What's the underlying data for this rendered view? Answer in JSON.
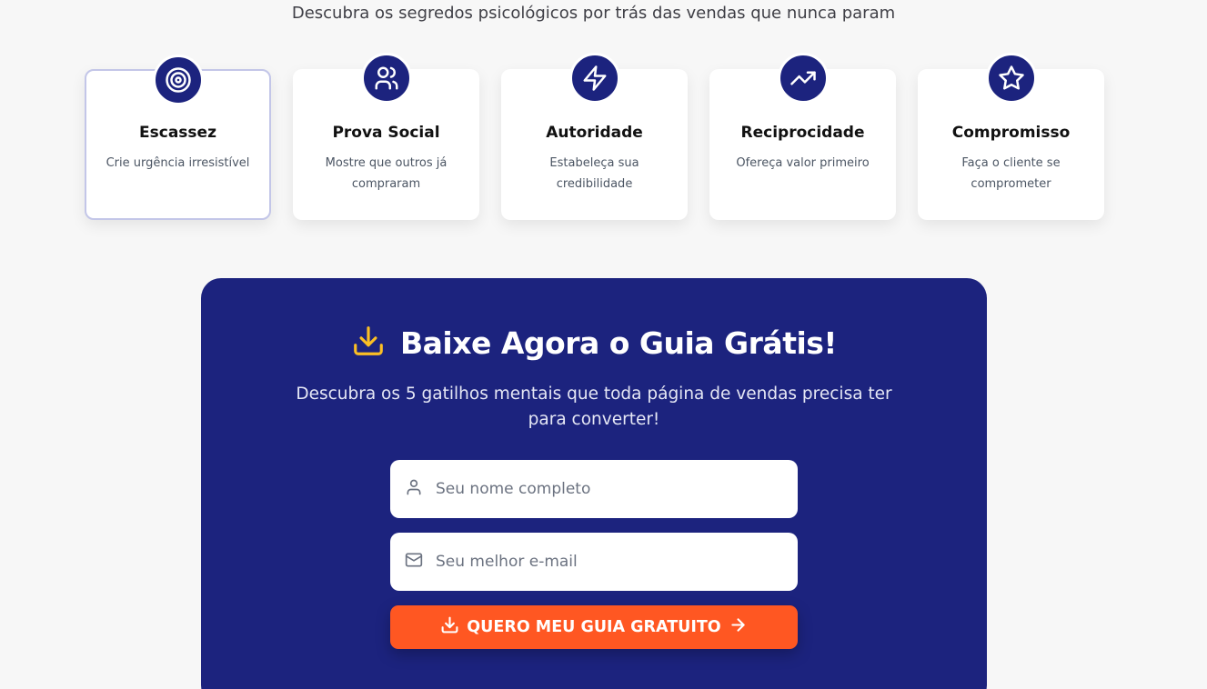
{
  "colors": {
    "primary": "#1c237e",
    "accent": "#ff5722",
    "highlight": "#fbbf24",
    "background": "#f7f7f7"
  },
  "header": {
    "subtitle": "Descubra os segredos psicológicos por trás das vendas que nunca param"
  },
  "triggers": [
    {
      "icon": "target-icon",
      "title": "Escassez",
      "description": "Crie urgência irresistível"
    },
    {
      "icon": "users-icon",
      "title": "Prova Social",
      "description": "Mostre que outros já compraram"
    },
    {
      "icon": "lightning-icon",
      "title": "Autoridade",
      "description": "Estabeleça sua credibilidade"
    },
    {
      "icon": "trending-up-icon",
      "title": "Reciprocidade",
      "description": "Ofereça valor primeiro"
    },
    {
      "icon": "star-icon",
      "title": "Compromisso",
      "description": "Faça o cliente se comprometer"
    }
  ],
  "cta": {
    "icon": "download-icon",
    "title": "Baixe Agora o Guia Grátis!",
    "description": "Descubra os 5 gatilhos mentais que toda página de vendas precisa ter para converter!",
    "name_field": {
      "icon": "user-icon",
      "placeholder": "Seu nome completo",
      "value": ""
    },
    "email_field": {
      "icon": "mail-icon",
      "placeholder": "Seu melhor e-mail",
      "value": ""
    },
    "submit": {
      "label": "QUERO MEU GUIA GRATUITO",
      "icon_left": "download-icon",
      "icon_right": "arrow-right-icon"
    }
  }
}
